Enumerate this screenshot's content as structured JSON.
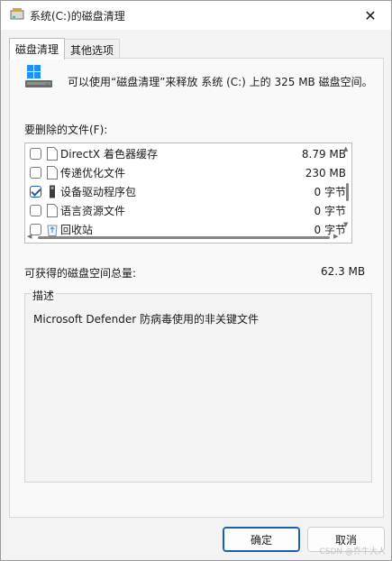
{
  "window": {
    "title": "系统(C:)的磁盘清理",
    "close_glyph": "✕"
  },
  "tabs": [
    {
      "label": "磁盘清理",
      "active": true
    },
    {
      "label": "其他选项",
      "active": false
    }
  ],
  "header": {
    "text": "可以使用“磁盘清理”来释放 系统 (C:) 上的 325 MB 磁盘空间。"
  },
  "files_label": "要删除的文件(F):",
  "file_list": [
    {
      "name": "DirectX 着色器缓存",
      "size": "8.79 MB",
      "checked": false,
      "icon": "file-icon"
    },
    {
      "name": "传递优化文件",
      "size": "230 MB",
      "checked": false,
      "icon": "file-icon"
    },
    {
      "name": "设备驱动程序包",
      "size": "0 字节",
      "checked": true,
      "icon": "driver-icon"
    },
    {
      "name": "语言资源文件",
      "size": "0 字节",
      "checked": false,
      "icon": "file-icon"
    },
    {
      "name": "回收站",
      "size": "0 字节",
      "checked": false,
      "icon": "recycle-bin-icon"
    }
  ],
  "space": {
    "label": "可获得的磁盘空间总量:",
    "value": "62.3 MB"
  },
  "description": {
    "title": "描述",
    "text": "Microsoft Defender 防病毒使用的非关键文件"
  },
  "buttons": {
    "ok": "确定",
    "cancel": "取消"
  },
  "watermark": "CSDN @乔牛大人",
  "colors": {
    "accent": "#1a5fb4",
    "window_bg": "#f3f3f3"
  }
}
